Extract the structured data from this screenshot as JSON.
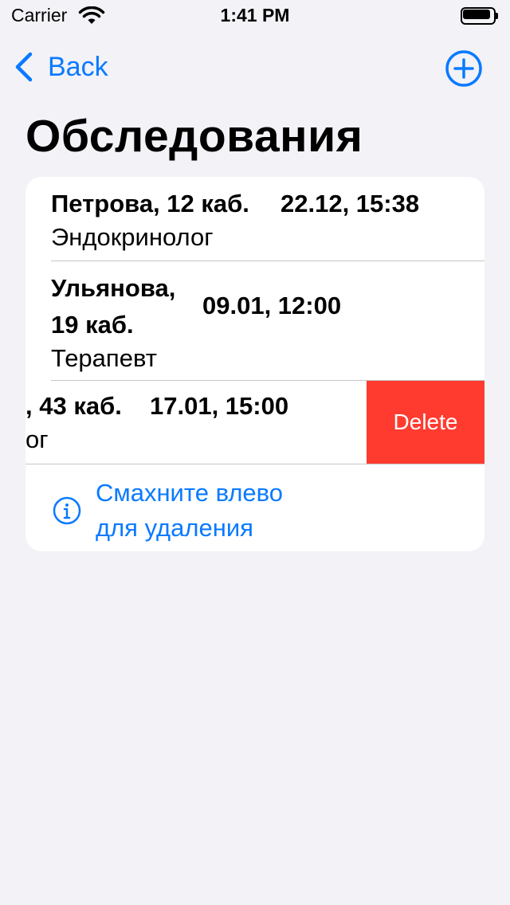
{
  "status_bar": {
    "carrier": "Carrier",
    "time": "1:41 PM"
  },
  "nav": {
    "back_label": "Back",
    "add_icon": "plus-circle-icon"
  },
  "page": {
    "title": "Обследования"
  },
  "appointments": [
    {
      "doctor": "Петрова, 12 каб.",
      "datetime": "22.12, 15:38",
      "specialty": "Эндокринолог"
    },
    {
      "doctor_line1": "Ульянова,",
      "doctor_line2": "19 каб.",
      "datetime": "09.01, 12:00",
      "specialty": "Терапевт"
    },
    {
      "doctor_visible": ", 43 каб.",
      "datetime": "17.01, 15:00",
      "specialty_visible": "ог",
      "action_label": "Delete"
    }
  ],
  "hint": {
    "line1": "Смахните влево",
    "line2": "для удаления",
    "icon": "info-circle-icon"
  },
  "colors": {
    "accent": "#0a7aff",
    "delete": "#ff3b30",
    "background": "#f2f2f7"
  }
}
